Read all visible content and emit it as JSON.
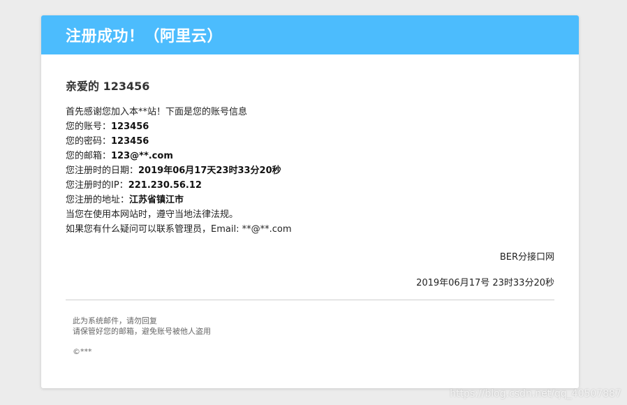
{
  "header": {
    "title": "注册成功！（阿里云）"
  },
  "greeting": {
    "prefix": "亲爱的",
    "username": "123456"
  },
  "intro": "首先感谢您加入本**站！下面是您的账号信息",
  "fields": [
    {
      "label": "您的账号：",
      "value": "123456"
    },
    {
      "label": "您的密码：",
      "value": "123456"
    },
    {
      "label": "您的邮箱：",
      "value": "123@**.com"
    },
    {
      "label": "您注册时的日期：",
      "value": "2019年06月17天23时33分20秒"
    },
    {
      "label": "您注册时的IP：",
      "value": "221.230.56.12"
    },
    {
      "label": "您注册的地址：",
      "value": "江苏省镇江市"
    }
  ],
  "notice": "当您在使用本网站时，遵守当地法律法规。",
  "contact": "如果您有什么疑问可以联系管理员，Email: **@**.com",
  "signature": {
    "site": "BER分接口网",
    "date": "2019年06月17号 23时33分20秒"
  },
  "footer": {
    "line1": "此为系统邮件，请勿回复",
    "line2": "请保管好您的邮箱，避免账号被他人盗用",
    "copyright": "©***"
  },
  "watermark": "https://blog.csdn.net/qq_40507887"
}
